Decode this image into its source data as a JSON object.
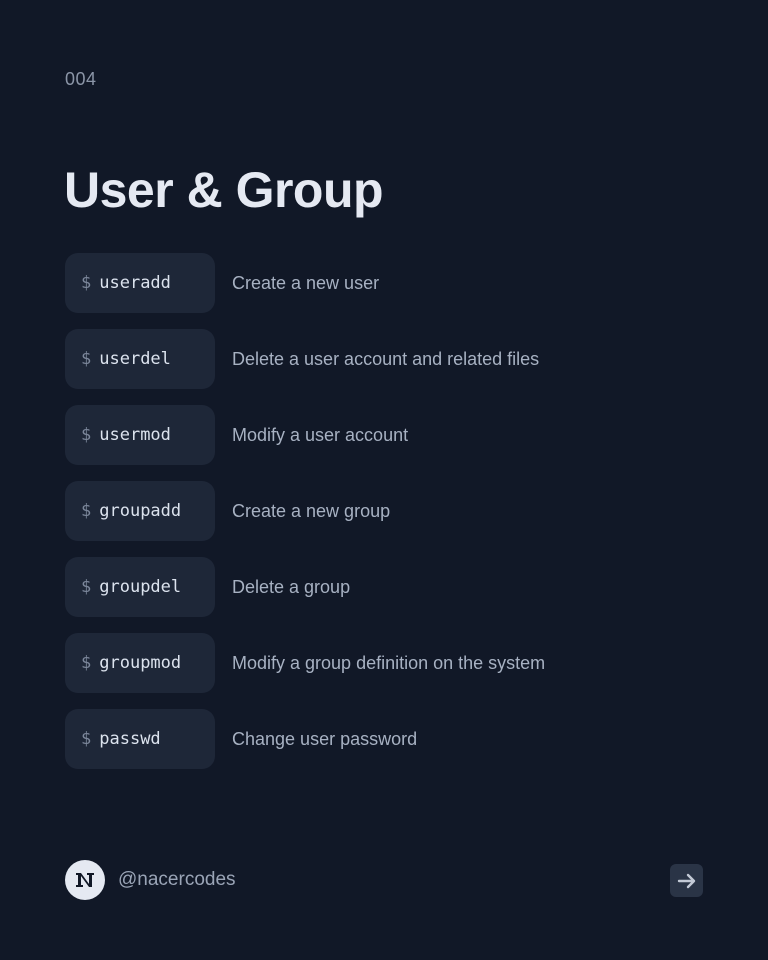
{
  "slide": {
    "number": "004",
    "title": "User & Group"
  },
  "commands": [
    {
      "prompt": "$",
      "name": "useradd",
      "description": "Create a new user"
    },
    {
      "prompt": "$",
      "name": "userdel",
      "description": "Delete a user account and related files"
    },
    {
      "prompt": "$",
      "name": "usermod",
      "description": "Modify a user account"
    },
    {
      "prompt": "$",
      "name": "groupadd",
      "description": "Create a new group"
    },
    {
      "prompt": "$",
      "name": "groupdel",
      "description": "Delete a group"
    },
    {
      "prompt": "$",
      "name": "groupmod",
      "description": "Modify a group definition on the system"
    },
    {
      "prompt": "$",
      "name": "passwd",
      "description": "Change user password"
    }
  ],
  "footer": {
    "avatar_icon": "nacercodes-logo-icon",
    "handle": "@nacercodes",
    "next_icon": "arrow-right-icon"
  },
  "colors": {
    "background": "#111827",
    "pill": "#1e2738",
    "title": "#e5e9f2",
    "description": "#a7b1c2",
    "prompt": "#7c879b"
  }
}
